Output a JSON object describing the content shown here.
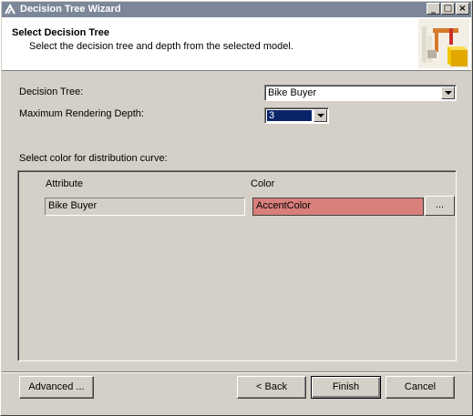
{
  "window": {
    "title": "Decision Tree Wizard",
    "controls": {
      "minimize": "_",
      "maximize": "□",
      "close": "×"
    }
  },
  "header": {
    "title": "Select Decision Tree",
    "subtitle": "Select the decision tree and depth from the selected model."
  },
  "form": {
    "tree_label": "Decision Tree:",
    "tree_value": "Bike Buyer",
    "depth_label": "Maximum Rendering Depth:",
    "depth_value": "3",
    "color_section_label": "Select color for distribution curve:"
  },
  "grid": {
    "columns": [
      "Attribute",
      "Color"
    ],
    "rows": [
      {
        "attribute": "Bike Buyer",
        "color": "AccentColor"
      }
    ],
    "ellipsis_label": "..."
  },
  "buttons": {
    "advanced": "Advanced ...",
    "back": "< Back",
    "finish": "Finish",
    "cancel": "Cancel"
  },
  "colors": {
    "accent_swatch": "#d87f7c",
    "selection": "#0a246a",
    "titlebar": "#7b8698"
  }
}
